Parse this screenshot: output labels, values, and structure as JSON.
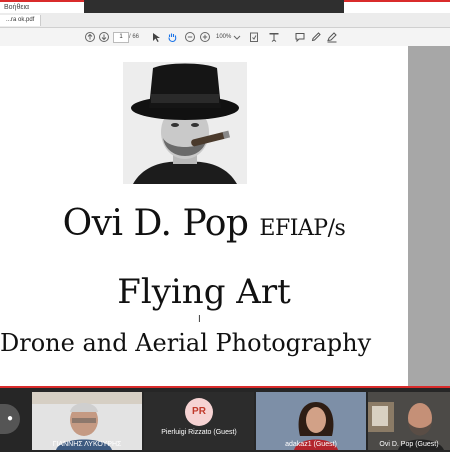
{
  "app": {
    "menu_text": "Βοήθεια",
    "tab_label": "...ra ok.pdf"
  },
  "toolbar": {
    "page_current": "1",
    "page_total": "/ 66",
    "zoom": "100%"
  },
  "document": {
    "name": "Ovi D. Pop",
    "name_suffix": "EFIAP/s",
    "title": "Flying Art",
    "subtitle": "Drone and Aerial Photography"
  },
  "participants": [
    {
      "name": "ΓΙΑΝΝΗΣ ΛΥΚΟΥΡΗΣ"
    },
    {
      "name": "Pierluigi Rizzato (Guest)",
      "initials": "PR"
    },
    {
      "name": "adakaz1 (Guest)"
    },
    {
      "name": "Ovi D. Pop (Guest)"
    }
  ],
  "colors": {
    "accent": "#d92b2b",
    "page_bg": "#ffffff",
    "gutter": "#a7a7a7",
    "strip_bg": "#262626"
  }
}
